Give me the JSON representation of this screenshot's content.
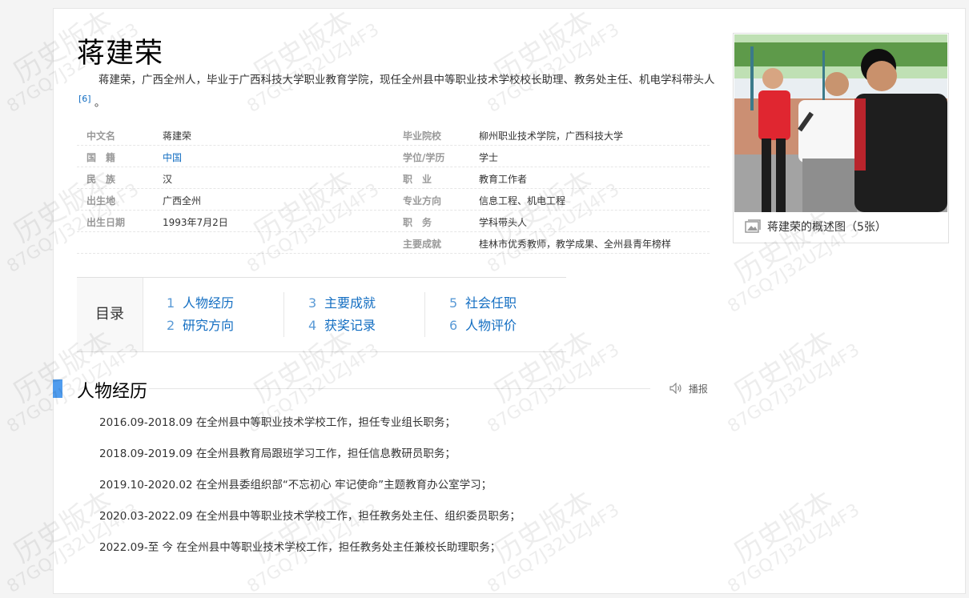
{
  "title": "蒋建荣",
  "summary": "蒋建荣，广西全州人，毕业于广西科技大学职业教育学院，现任全州县中等职业技术学校校长助理、教务处主任、机电学科带头人",
  "summary_ref": "[6]",
  "summary_end": "。",
  "basic_info": {
    "left": [
      {
        "name": "中文名",
        "value": "蒋建荣"
      },
      {
        "name": "国　籍",
        "value": "中国"
      },
      {
        "name": "民　族",
        "value": "汉"
      },
      {
        "name": "出生地",
        "value": "广西全州"
      },
      {
        "name": "出生日期",
        "value": "1993年7月2日"
      }
    ],
    "right": [
      {
        "name": "毕业院校",
        "value": "柳州职业技术学院，广西科技大学"
      },
      {
        "name": "学位/学历",
        "value": "学士"
      },
      {
        "name": "职　业",
        "value": "教育工作者"
      },
      {
        "name": "专业方向",
        "value": "信息工程、机电工程"
      },
      {
        "name": "职　务",
        "value": "学科带头人"
      },
      {
        "name": "主要成就",
        "value": "桂林市优秀教师，教学成果、全州县青年榜样"
      }
    ]
  },
  "summary_pic": {
    "caption": "蒋建荣的概述图（5张）"
  },
  "catalog": {
    "title": "目录",
    "items": [
      {
        "num": "1",
        "label": "人物经历"
      },
      {
        "num": "2",
        "label": "研究方向"
      },
      {
        "num": "3",
        "label": "主要成就"
      },
      {
        "num": "4",
        "label": "获奖记录"
      },
      {
        "num": "5",
        "label": "社会任职"
      },
      {
        "num": "6",
        "label": "人物评价"
      }
    ]
  },
  "section": {
    "title": "人物经历",
    "audio_label": "播报",
    "paragraphs": [
      "2016.09-2018.09 在全州县中等职业技术学校工作，担任专业组长职务；",
      "2018.09-2019.09 在全州县教育局跟班学习工作，担任信息教研员职务；",
      "2019.10-2020.02 在全州县委组织部“不忘初心 牢记使命”主题教育办公室学习；",
      "2020.03-2022.09 在全州县中等职业技术学校工作，担任教务处主任、组织委员职务；",
      "2022.09-至 今 在全州县中等职业技术学校工作，担任教务处主任兼校长助理职务；"
    ]
  },
  "watermark": {
    "text": "历史版本",
    "code": "87GQ7J32UZJ4F3"
  },
  "colors": {
    "link": "#136ec2",
    "section_bar": "#4f9cee"
  }
}
